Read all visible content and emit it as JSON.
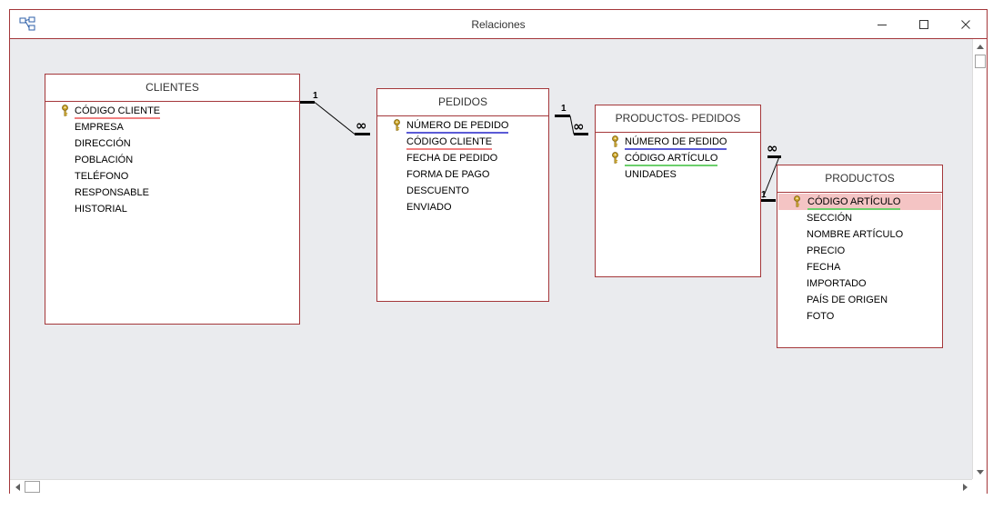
{
  "window": {
    "title": "Relaciones"
  },
  "tables": [
    {
      "id": "clientes",
      "title": "CLIENTES",
      "fields": [
        {
          "name": "CÓDIGO CLIENTE",
          "key": true,
          "underline": "red"
        },
        {
          "name": "EMPRESA"
        },
        {
          "name": "DIRECCIÓN"
        },
        {
          "name": "POBLACIÓN"
        },
        {
          "name": "TELÉFONO"
        },
        {
          "name": "RESPONSABLE"
        },
        {
          "name": "HISTORIAL"
        }
      ]
    },
    {
      "id": "pedidos",
      "title": "PEDIDOS",
      "fields": [
        {
          "name": "NÚMERO DE PEDIDO",
          "key": true,
          "underline": "blue"
        },
        {
          "name": "CÓDIGO CLIENTE",
          "underline": "red"
        },
        {
          "name": "FECHA DE PEDIDO"
        },
        {
          "name": "FORMA DE PAGO"
        },
        {
          "name": "DESCUENTO"
        },
        {
          "name": "ENVIADO"
        }
      ]
    },
    {
      "id": "productos-pedidos",
      "title": "PRODUCTOS- PEDIDOS",
      "fields": [
        {
          "name": "NÚMERO DE PEDIDO",
          "key": true,
          "underline": "blue"
        },
        {
          "name": "CÓDIGO ARTÍCULO",
          "key": true,
          "underline": "green"
        },
        {
          "name": "UNIDADES"
        }
      ]
    },
    {
      "id": "productos",
      "title": "PRODUCTOS",
      "fields": [
        {
          "name": "CÓDIGO ARTÍCULO",
          "key": true,
          "underline": "green",
          "selected": true
        },
        {
          "name": "SECCIÓN"
        },
        {
          "name": "NOMBRE ARTÍCULO"
        },
        {
          "name": "PRECIO"
        },
        {
          "name": "FECHA"
        },
        {
          "name": "IMPORTADO"
        },
        {
          "name": "PAÍS DE ORIGEN"
        },
        {
          "name": "FOTO"
        }
      ]
    }
  ],
  "relationships": [
    {
      "from": "clientes",
      "to": "pedidos",
      "from_label": "1",
      "to_label": "∞"
    },
    {
      "from": "pedidos",
      "to": "productos-pedidos",
      "from_label": "1",
      "to_label": "∞"
    },
    {
      "from": "productos",
      "to": "productos-pedidos",
      "from_label": "1",
      "to_label": "∞"
    }
  ],
  "colors": {
    "border_accent": "#a4373a",
    "canvas_background": "#eaebee",
    "key_icon": "#c9a227",
    "underline_red": "#f08080",
    "underline_blue": "#5b5bd6",
    "underline_green": "#6ccf6c",
    "selected_row": "#f4c4c4"
  },
  "icons": {
    "app": "relationships-icon",
    "minimize": "minimize-icon",
    "maximize": "maximize-icon",
    "close": "close-icon",
    "primary_key": "key-icon"
  }
}
